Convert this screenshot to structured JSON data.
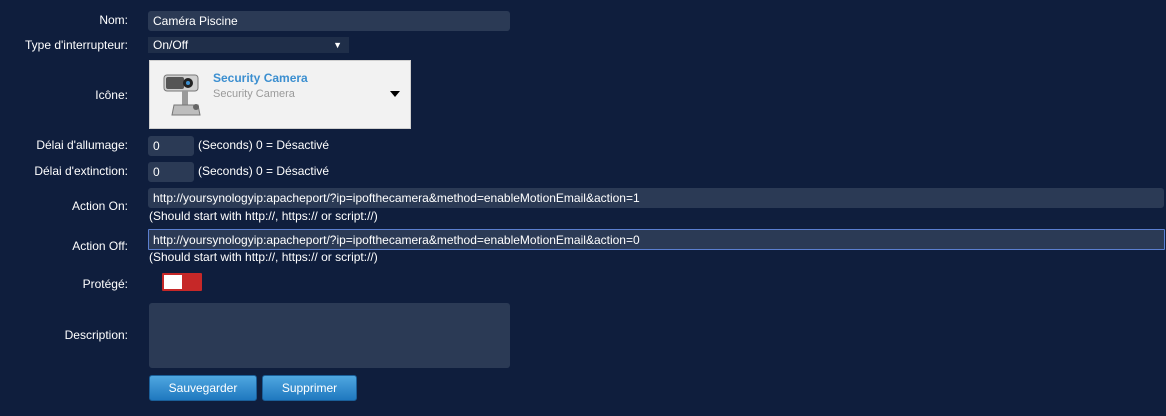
{
  "form": {
    "name": {
      "label": "Nom:",
      "value": "Caméra Piscine"
    },
    "switch_type": {
      "label": "Type d'interrupteur:",
      "selected": "On/Off"
    },
    "icon": {
      "label": "Icône:",
      "title": "Security Camera",
      "subtitle": "Security Camera",
      "icon_name": "security-camera-icon"
    },
    "on_delay": {
      "label": "Délai d'allumage:",
      "value": "0",
      "hint": "(Seconds) 0 = Désactivé"
    },
    "off_delay": {
      "label": "Délai d'extinction:",
      "value": "0",
      "hint": "(Seconds) 0 = Désactivé"
    },
    "action_on": {
      "label": "Action On:",
      "value": "http://yoursynologyip:apacheport/?ip=ipofthecamera&method=enableMotionEmail&action=1",
      "hint": "(Should start with http://, https:// or script://)"
    },
    "action_off": {
      "label": "Action Off:",
      "value": "http://yoursynologyip:apacheport/?ip=ipofthecamera&method=enableMotionEmail&action=0",
      "hint": "(Should start with http://, https:// or script://)"
    },
    "protected": {
      "label": "Protégé:",
      "state": "off"
    },
    "description": {
      "label": "Description:",
      "value": ""
    }
  },
  "buttons": {
    "save": "Sauvegarder",
    "delete": "Supprimer"
  },
  "colors": {
    "background": "#0f1e3d",
    "input": "#2b3a55",
    "accent": "#3c8fd0",
    "toggle_off": "#c62828"
  }
}
